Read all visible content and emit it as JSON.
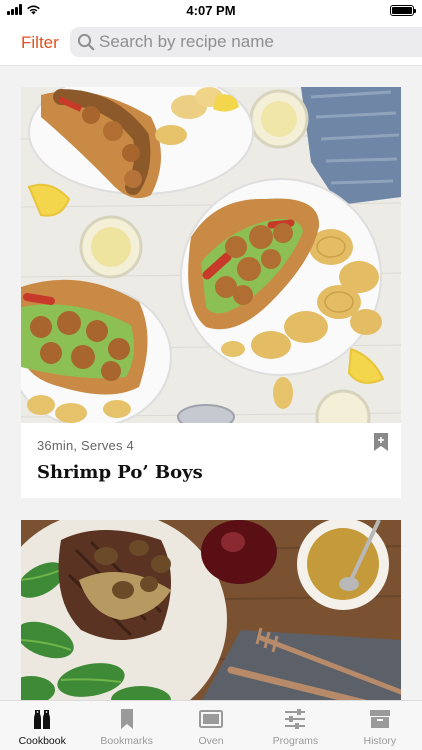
{
  "status_bar": {
    "time": "4:07 PM"
  },
  "header": {
    "filter_label": "Filter",
    "search_placeholder": "Search by recipe name"
  },
  "recipes": [
    {
      "meta": "36min, Serves 4",
      "title": "Shrimp Po’ Boys",
      "image": "shrimp-po-boy-sandwiches-photo",
      "bookmark_icon": "bookmark-icon"
    },
    {
      "image": "steak-mushrooms-salad-photo"
    }
  ],
  "tabs": [
    {
      "label": "Cookbook",
      "icon": "salt-pepper-icon",
      "active": true
    },
    {
      "label": "Bookmarks",
      "icon": "bookmark-icon",
      "active": false
    },
    {
      "label": "Oven",
      "icon": "oven-icon",
      "active": false
    },
    {
      "label": "Programs",
      "icon": "sliders-icon",
      "active": false
    },
    {
      "label": "History",
      "icon": "archive-box-icon",
      "active": false
    }
  ],
  "colors": {
    "accent": "#e0521f",
    "tab_active": "#111111",
    "tab_inactive": "#9a9a9a",
    "background": "#f2f2f2"
  }
}
